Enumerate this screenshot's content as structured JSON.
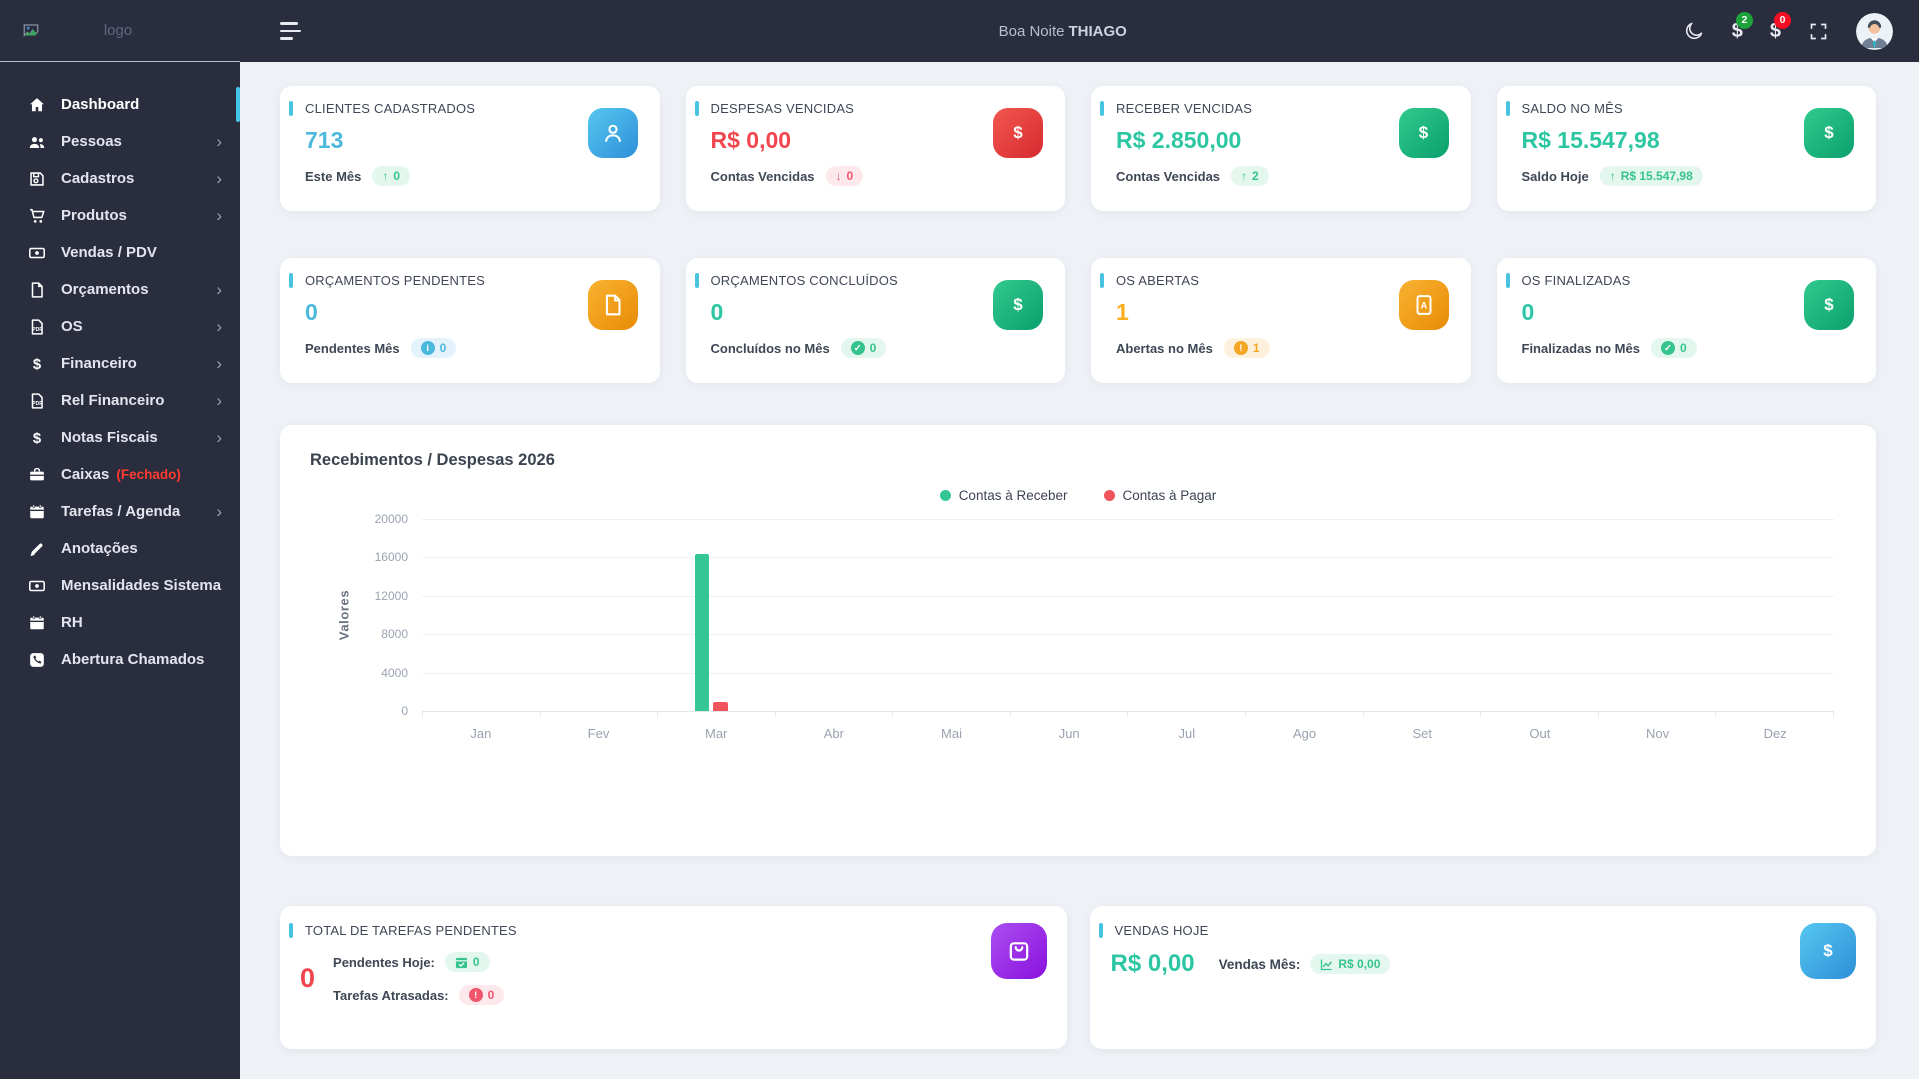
{
  "colors": {
    "sidebar_bg": "#2a2d3e",
    "content_bg": "#eef1f6",
    "accent_cyan": "#49c3e2",
    "teal": "#2cc6a2",
    "red": "#f2464f",
    "blue": "#4cb8dc",
    "orange": "#f8ad1d"
  },
  "header": {
    "greeting": "Boa Noite",
    "username": "THIAGO",
    "money_badge_green": "2",
    "money_badge_red": "0"
  },
  "sidebar": {
    "logo_alt": "logo",
    "items": [
      {
        "label": "Dashboard",
        "icon": "home",
        "active": true
      },
      {
        "label": "Pessoas",
        "icon": "users",
        "chevron": true
      },
      {
        "label": "Cadastros",
        "icon": "save",
        "chevron": true
      },
      {
        "label": "Produtos",
        "icon": "cart",
        "chevron": true
      },
      {
        "label": "Vendas / PDV",
        "icon": "money"
      },
      {
        "label": "Orçamentos",
        "icon": "file",
        "chevron": true
      },
      {
        "label": "OS",
        "icon": "file-pdf",
        "chevron": true
      },
      {
        "label": "Financeiro",
        "icon": "dollar",
        "chevron": true
      },
      {
        "label": "Rel Financeiro",
        "icon": "file-pdf",
        "chevron": true
      },
      {
        "label": "Notas Fiscais",
        "icon": "dollar",
        "chevron": true
      },
      {
        "label": "Caixas",
        "suffix": "(Fechado)",
        "icon": "briefcase"
      },
      {
        "label": "Tarefas / Agenda",
        "icon": "calendar",
        "chevron": true
      },
      {
        "label": "Anotações",
        "icon": "pen"
      },
      {
        "label": "Mensalidades Sistema",
        "icon": "money"
      },
      {
        "label": "RH",
        "icon": "calendar"
      },
      {
        "label": "Abertura Chamados",
        "icon": "phone"
      }
    ]
  },
  "stat_cards": [
    {
      "title": "CLIENTES CADASTRADOS",
      "value": "713",
      "value_color": "blue",
      "label": "Este Mês",
      "badge": {
        "style": "green",
        "icon": "arrow-up",
        "text": "0"
      },
      "icon": "person",
      "icon_style": "blue"
    },
    {
      "title": "DESPESAS VENCIDAS",
      "value": "R$ 0,00",
      "value_color": "red",
      "label": "Contas Vencidas",
      "badge": {
        "style": "red",
        "icon": "arrow-down",
        "text": "0"
      },
      "icon": "dollar",
      "icon_style": "red"
    },
    {
      "title": "RECEBER VENCIDAS",
      "value": "R$ 2.850,00",
      "value_color": "teal",
      "label": "Contas Vencidas",
      "badge": {
        "style": "green",
        "icon": "arrow-up",
        "text": "2"
      },
      "icon": "dollar",
      "icon_style": "green"
    },
    {
      "title": "SALDO NO MÊS",
      "value": "R$ 15.547,98",
      "value_color": "teal",
      "label": "Saldo Hoje",
      "badge": {
        "style": "green",
        "icon": "arrow-up",
        "text": "R$ 15.547,98"
      },
      "icon": "dollar",
      "icon_style": "green"
    },
    {
      "title": "ORÇAMENTOS PENDENTES",
      "value": "0",
      "value_color": "blue",
      "label": "Pendentes Mês",
      "badge": {
        "style": "blue",
        "icon": "info",
        "text": "0"
      },
      "icon": "file",
      "icon_style": "orange"
    },
    {
      "title": "ORÇAMENTOS CONCLUÍDOS",
      "value": "0",
      "value_color": "teal",
      "label": "Concluídos no Mês",
      "badge": {
        "style": "green",
        "icon": "check",
        "text": "0"
      },
      "icon": "dollar",
      "icon_style": "green"
    },
    {
      "title": "OS ABERTAS",
      "value": "1",
      "value_color": "orange",
      "label": "Abertas no Mês",
      "badge": {
        "style": "orange",
        "icon": "exclamation",
        "text": "1"
      },
      "icon": "file-pdf",
      "icon_style": "orange"
    },
    {
      "title": "OS FINALIZADAS",
      "value": "0",
      "value_color": "teal",
      "label": "Finalizadas no Mês",
      "badge": {
        "style": "green",
        "icon": "check",
        "text": "0"
      },
      "icon": "dollar",
      "icon_style": "green"
    }
  ],
  "chart_data": {
    "type": "bar",
    "title": "Recebimentos / Despesas 2026",
    "ylabel": "Valores",
    "categories": [
      "Jan",
      "Fev",
      "Mar",
      "Abr",
      "Mai",
      "Jun",
      "Jul",
      "Ago",
      "Set",
      "Out",
      "Nov",
      "Dez"
    ],
    "series": [
      {
        "name": "Contas à Receber",
        "color": "#34c795",
        "values": [
          0,
          0,
          16400,
          0,
          0,
          0,
          0,
          0,
          0,
          0,
          0,
          0
        ]
      },
      {
        "name": "Contas à Pagar",
        "color": "#f0545c",
        "values": [
          0,
          0,
          950,
          0,
          0,
          0,
          0,
          0,
          0,
          0,
          0,
          0
        ]
      }
    ],
    "y_ticks": [
      20000,
      16000,
      12000,
      8000,
      4000,
      0
    ],
    "ylim": [
      0,
      20000
    ],
    "grid": true,
    "legend_position": "top-center"
  },
  "bottom_cards": {
    "tasks": {
      "title": "TOTAL DE TAREFAS PENDENTES",
      "value": "0",
      "rows": [
        {
          "label": "Pendentes Hoje:",
          "badge": {
            "style": "green",
            "icon": "calendar-check",
            "text": "0"
          }
        },
        {
          "label": "Tarefas Atrasadas:",
          "badge": {
            "style": "red",
            "icon": "exclamation",
            "text": "0"
          }
        }
      ],
      "icon": "clipboard",
      "icon_style": "purple"
    },
    "sales": {
      "title": "VENDAS HOJE",
      "value": "R$ 0,00",
      "label": "Vendas Mês:",
      "badge": {
        "style": "green",
        "icon": "chart-line",
        "text": "R$ 0,00"
      },
      "icon": "dollar",
      "icon_style": "blue"
    }
  }
}
